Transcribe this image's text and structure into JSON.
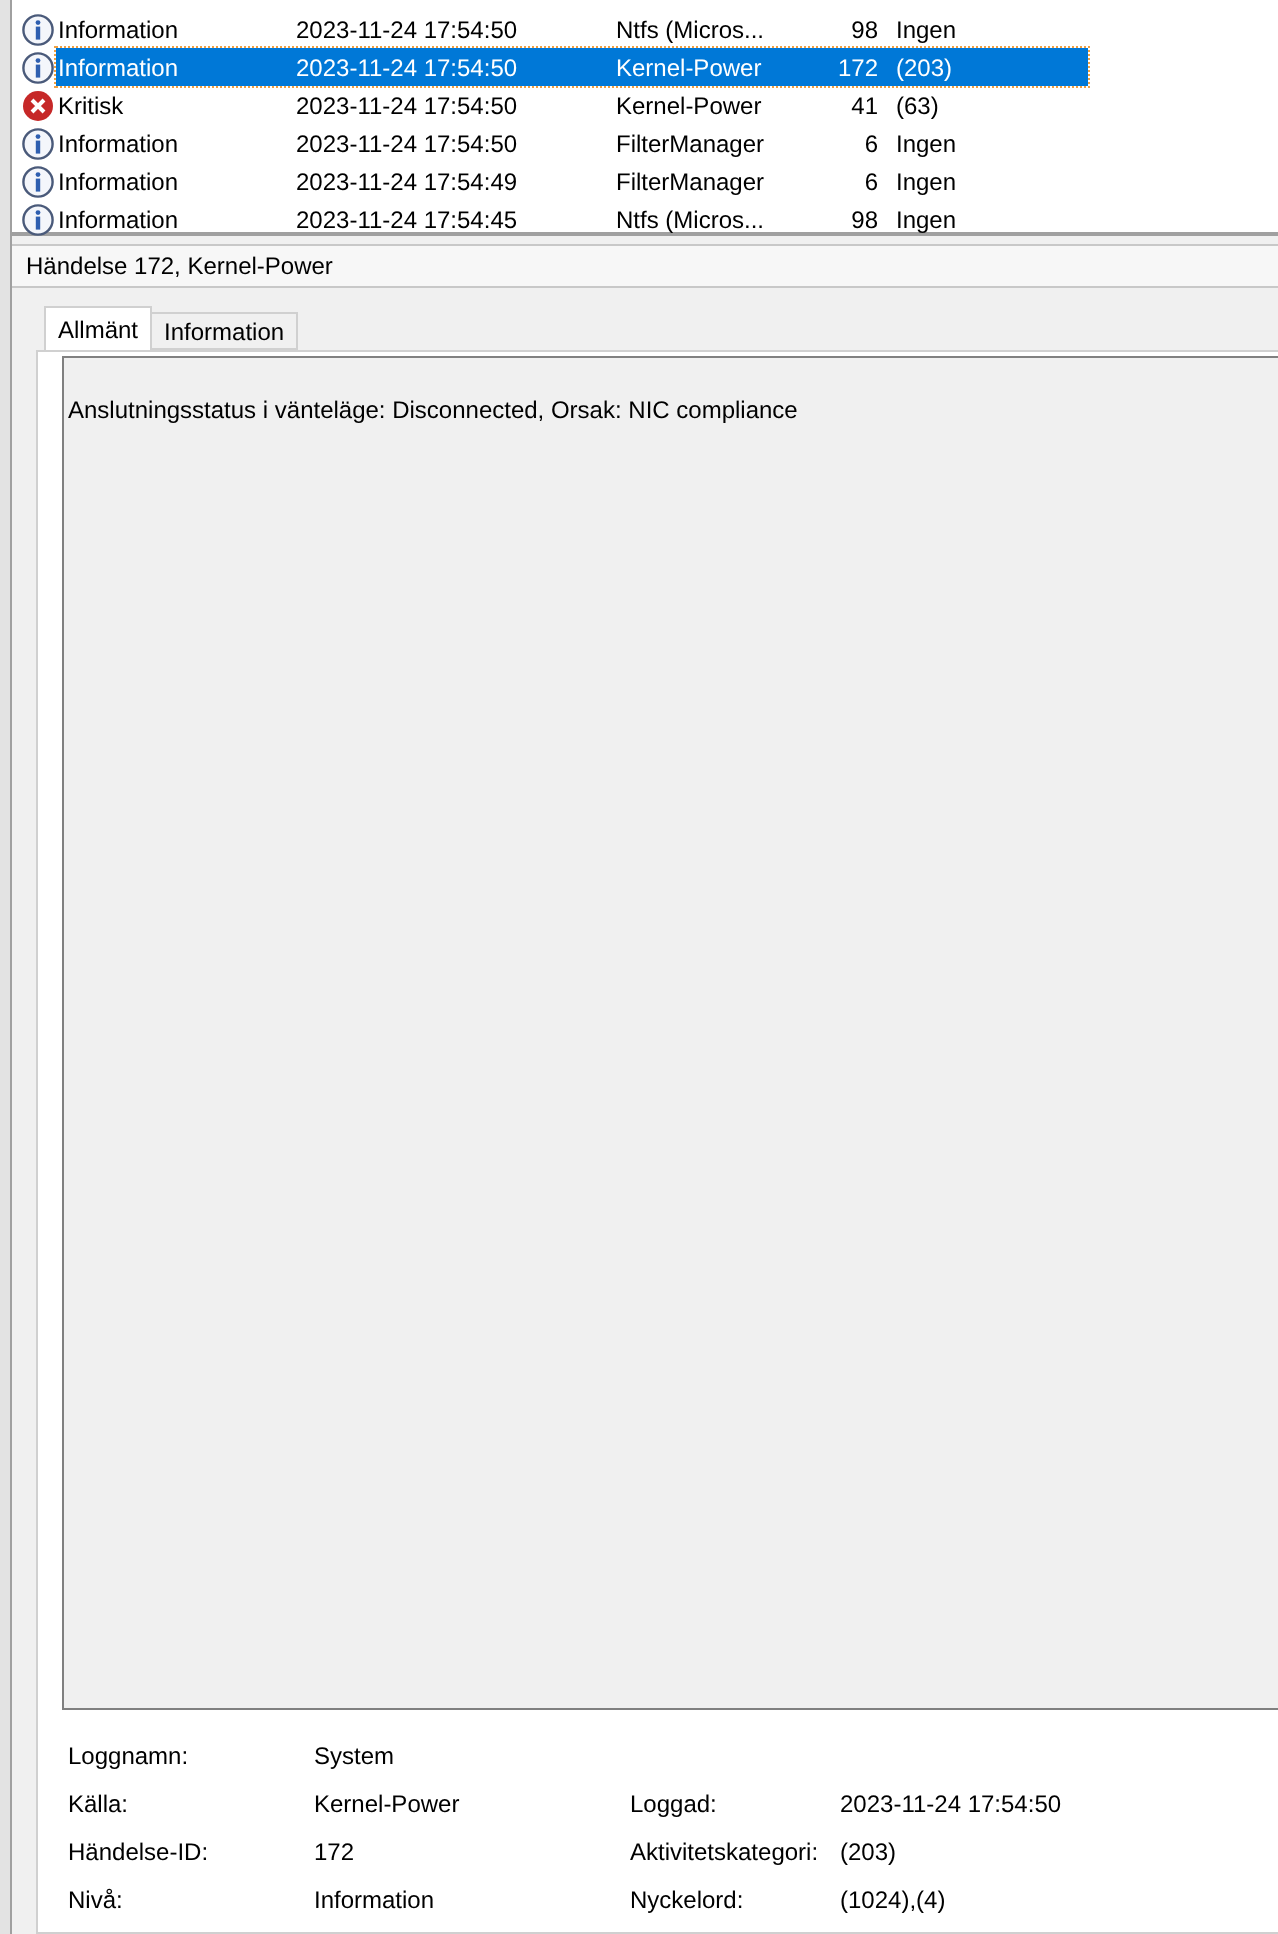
{
  "events": [
    {
      "kind": "info",
      "level": "Information",
      "date": "2023-11-24 17:54:50",
      "source": "Ntfs (Micros...",
      "event_id": "98",
      "category": "Ingen",
      "selected": false
    },
    {
      "kind": "info",
      "level": "Information",
      "date": "2023-11-24 17:54:50",
      "source": "Kernel-Power",
      "event_id": "172",
      "category": "(203)",
      "selected": true
    },
    {
      "kind": "critical",
      "level": "Kritisk",
      "date": "2023-11-24 17:54:50",
      "source": "Kernel-Power",
      "event_id": "41",
      "category": "(63)",
      "selected": false
    },
    {
      "kind": "info",
      "level": "Information",
      "date": "2023-11-24 17:54:50",
      "source": "FilterManager",
      "event_id": "6",
      "category": "Ingen",
      "selected": false
    },
    {
      "kind": "info",
      "level": "Information",
      "date": "2023-11-24 17:54:49",
      "source": "FilterManager",
      "event_id": "6",
      "category": "Ingen",
      "selected": false
    },
    {
      "kind": "info",
      "level": "Information",
      "date": "2023-11-24 17:54:45",
      "source": "Ntfs (Micros...",
      "event_id": "98",
      "category": "Ingen",
      "selected": false
    }
  ],
  "detail_title": "Händelse 172, Kernel-Power",
  "tabs": [
    {
      "label": "Allmänt",
      "selected": true
    },
    {
      "label": "Information",
      "selected": false
    }
  ],
  "description": "Anslutningsstatus i vänteläge: Disconnected, Orsak: NIC compliance",
  "fields": [
    {
      "label": "Loggnamn:",
      "value": "System"
    },
    {
      "label": "Källa:",
      "value": "Kernel-Power",
      "label2": "Loggad:",
      "value2": "2023-11-24 17:54:50"
    },
    {
      "label": "Händelse-ID:",
      "value": "172",
      "label2": "Aktivitetskategori:",
      "value2": "(203)"
    },
    {
      "label": "Nivå:",
      "value": "Information",
      "label2": "Nyckelord:",
      "value2": "(1024),(4)"
    }
  ]
}
